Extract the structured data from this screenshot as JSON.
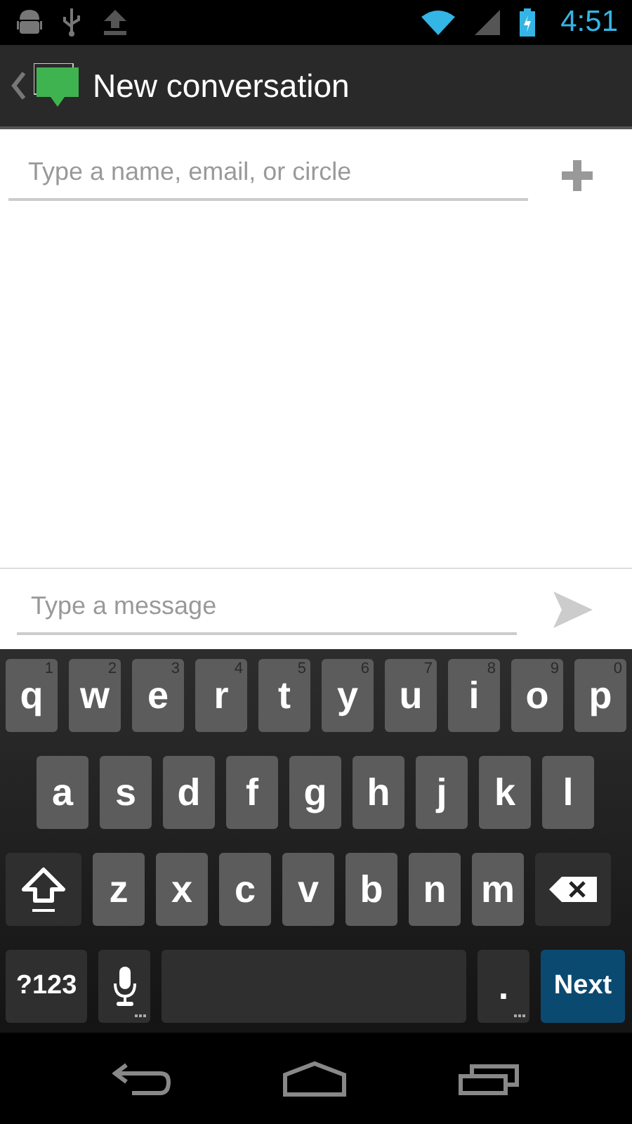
{
  "status_bar": {
    "time": "4:51"
  },
  "action_bar": {
    "title": "New conversation"
  },
  "recipient_field": {
    "placeholder": "Type a name, email, or circle"
  },
  "message_field": {
    "placeholder": "Type a message"
  },
  "keyboard": {
    "rows": [
      {
        "keys": [
          {
            "kind": "letter",
            "label": "q",
            "hint": "1"
          },
          {
            "kind": "letter",
            "label": "w",
            "hint": "2"
          },
          {
            "kind": "letter",
            "label": "e",
            "hint": "3"
          },
          {
            "kind": "letter",
            "label": "r",
            "hint": "4"
          },
          {
            "kind": "letter",
            "label": "t",
            "hint": "5"
          },
          {
            "kind": "letter",
            "label": "y",
            "hint": "6"
          },
          {
            "kind": "letter",
            "label": "u",
            "hint": "7"
          },
          {
            "kind": "letter",
            "label": "i",
            "hint": "8"
          },
          {
            "kind": "letter",
            "label": "o",
            "hint": "9"
          },
          {
            "kind": "letter",
            "label": "p",
            "hint": "0"
          }
        ]
      },
      {
        "keys": [
          {
            "kind": "letter",
            "label": "a"
          },
          {
            "kind": "letter",
            "label": "s"
          },
          {
            "kind": "letter",
            "label": "d"
          },
          {
            "kind": "letter",
            "label": "f"
          },
          {
            "kind": "letter",
            "label": "g"
          },
          {
            "kind": "letter",
            "label": "h"
          },
          {
            "kind": "letter",
            "label": "j"
          },
          {
            "kind": "letter",
            "label": "k"
          },
          {
            "kind": "letter",
            "label": "l"
          }
        ]
      },
      {
        "keys": [
          {
            "kind": "shift"
          },
          {
            "kind": "letter",
            "label": "z"
          },
          {
            "kind": "letter",
            "label": "x"
          },
          {
            "kind": "letter",
            "label": "c"
          },
          {
            "kind": "letter",
            "label": "v"
          },
          {
            "kind": "letter",
            "label": "b"
          },
          {
            "kind": "letter",
            "label": "n"
          },
          {
            "kind": "letter",
            "label": "m"
          },
          {
            "kind": "delete"
          }
        ]
      },
      {
        "keys": [
          {
            "kind": "symbols",
            "label": "?123"
          },
          {
            "kind": "mic"
          },
          {
            "kind": "space"
          },
          {
            "kind": "period",
            "label": "."
          },
          {
            "kind": "action",
            "label": "Next"
          }
        ]
      }
    ]
  }
}
